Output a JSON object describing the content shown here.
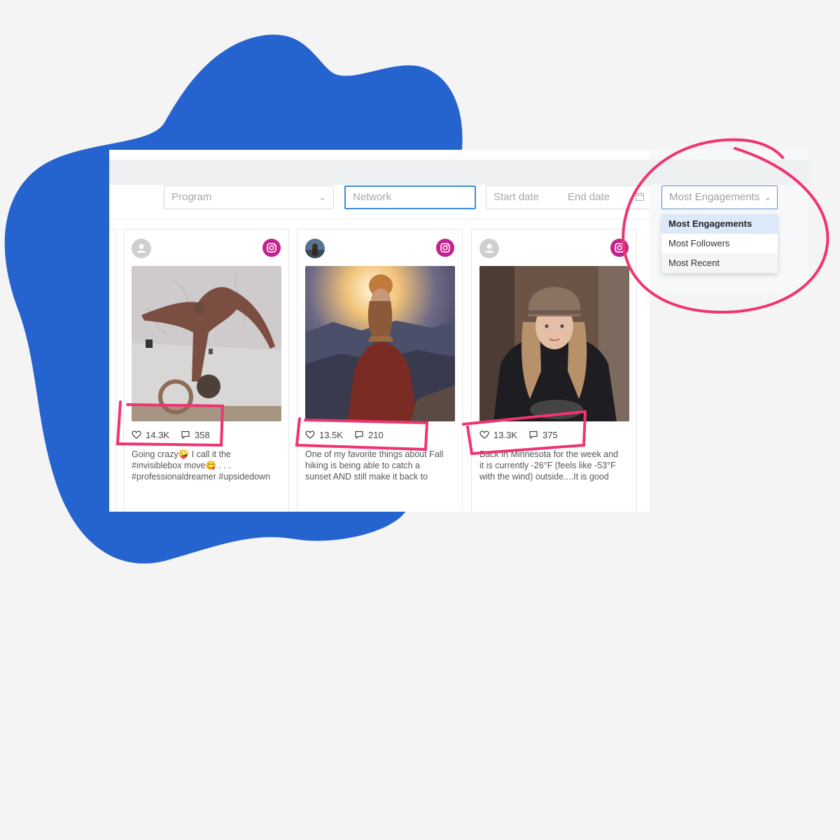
{
  "colors": {
    "blob": "#2563cf",
    "accent_pink": "#f0346f",
    "instagram": "#c2248f",
    "focus_blue": "#3d8be0"
  },
  "filters": {
    "program": {
      "placeholder": "Program",
      "icon": "chevron-down-icon"
    },
    "network": {
      "placeholder": "Network"
    },
    "date_range": {
      "start_placeholder": "Start date",
      "end_placeholder": "End date",
      "icon": "calendar-icon"
    },
    "sort": {
      "selected": "Most Engagements",
      "icon": "chevron-down-icon",
      "options": [
        "Most Engagements",
        "Most Followers",
        "Most Recent"
      ]
    }
  },
  "posts": [
    {
      "network_icon": "instagram-icon",
      "likes": "14.3K",
      "comments": "358",
      "caption": "Going crazy🤪 I call it the\n#invisiblebox move😋 . . .\n#professionaldreamer #upsidedown"
    },
    {
      "network_icon": "instagram-icon",
      "likes": "13.5K",
      "comments": "210",
      "caption": "One of my favorite things about Fall\nhiking is being able to catch a\nsunset AND still make it back to"
    },
    {
      "network_icon": "instagram-icon",
      "likes": "13.3K",
      "comments": "375",
      "caption": "Back in Minnesota for the week and\nit is currently -26°F (feels like -53°F\nwith the wind) outside....It is good"
    }
  ]
}
